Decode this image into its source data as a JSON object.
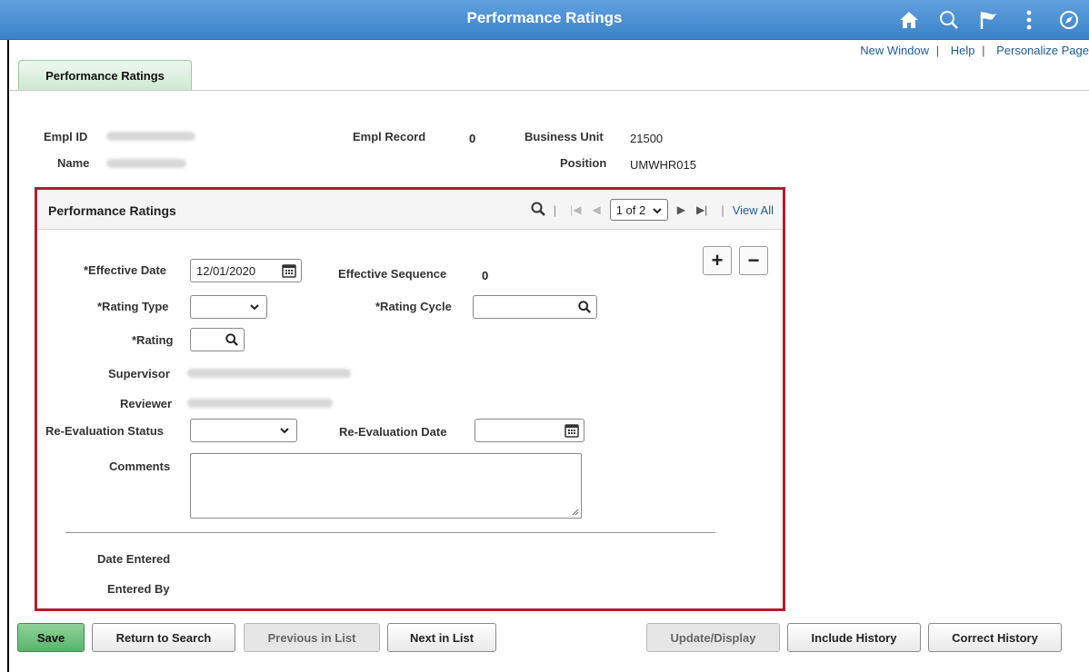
{
  "header": {
    "title": "Performance Ratings",
    "icons": [
      "home-icon",
      "search-icon",
      "flag-icon",
      "more-vertical-icon",
      "compass-icon"
    ]
  },
  "toplinks": {
    "new_window": "New Window",
    "help": "Help",
    "personalize": "Personalize Page",
    "sep": "|"
  },
  "tab": {
    "label": "Performance Ratings"
  },
  "key": {
    "empl_id_label": "Empl ID",
    "name_label": "Name",
    "empl_record_label": "Empl Record",
    "empl_record_value": "0",
    "business_unit_label": "Business Unit",
    "business_unit_value": "21500",
    "position_label": "Position",
    "position_value": "UMWHR015"
  },
  "grid": {
    "title": "Performance Ratings",
    "pager_value": "1 of 2",
    "view_all": "View All",
    "pipe": "|"
  },
  "form": {
    "effective_date_label": "*Effective Date",
    "effective_date_value": "12/01/2020",
    "effective_sequence_label": "Effective Sequence",
    "effective_sequence_value": "0",
    "rating_type_label": "*Rating Type",
    "rating_cycle_label": "*Rating Cycle",
    "rating_label": "*Rating",
    "supervisor_label": "Supervisor",
    "reviewer_label": "Reviewer",
    "reevaluation_status_label": "Re-Evaluation Status",
    "reevaluation_date_label": "Re-Evaluation Date",
    "comments_label": "Comments",
    "date_entered_label": "Date Entered",
    "entered_by_label": "Entered By",
    "add_row": "+",
    "delete_row": "−"
  },
  "buttons": {
    "save": "Save",
    "return_to_search": "Return to Search",
    "previous_in_list": "Previous in List",
    "next_in_list": "Next in List",
    "update_display": "Update/Display",
    "include_history": "Include History",
    "correct_history": "Correct History"
  },
  "colors": {
    "header": "#4a8fd4",
    "panel_border": "#b01d2e",
    "save_button": "#6cc07b",
    "link": "#1f5b9a"
  }
}
